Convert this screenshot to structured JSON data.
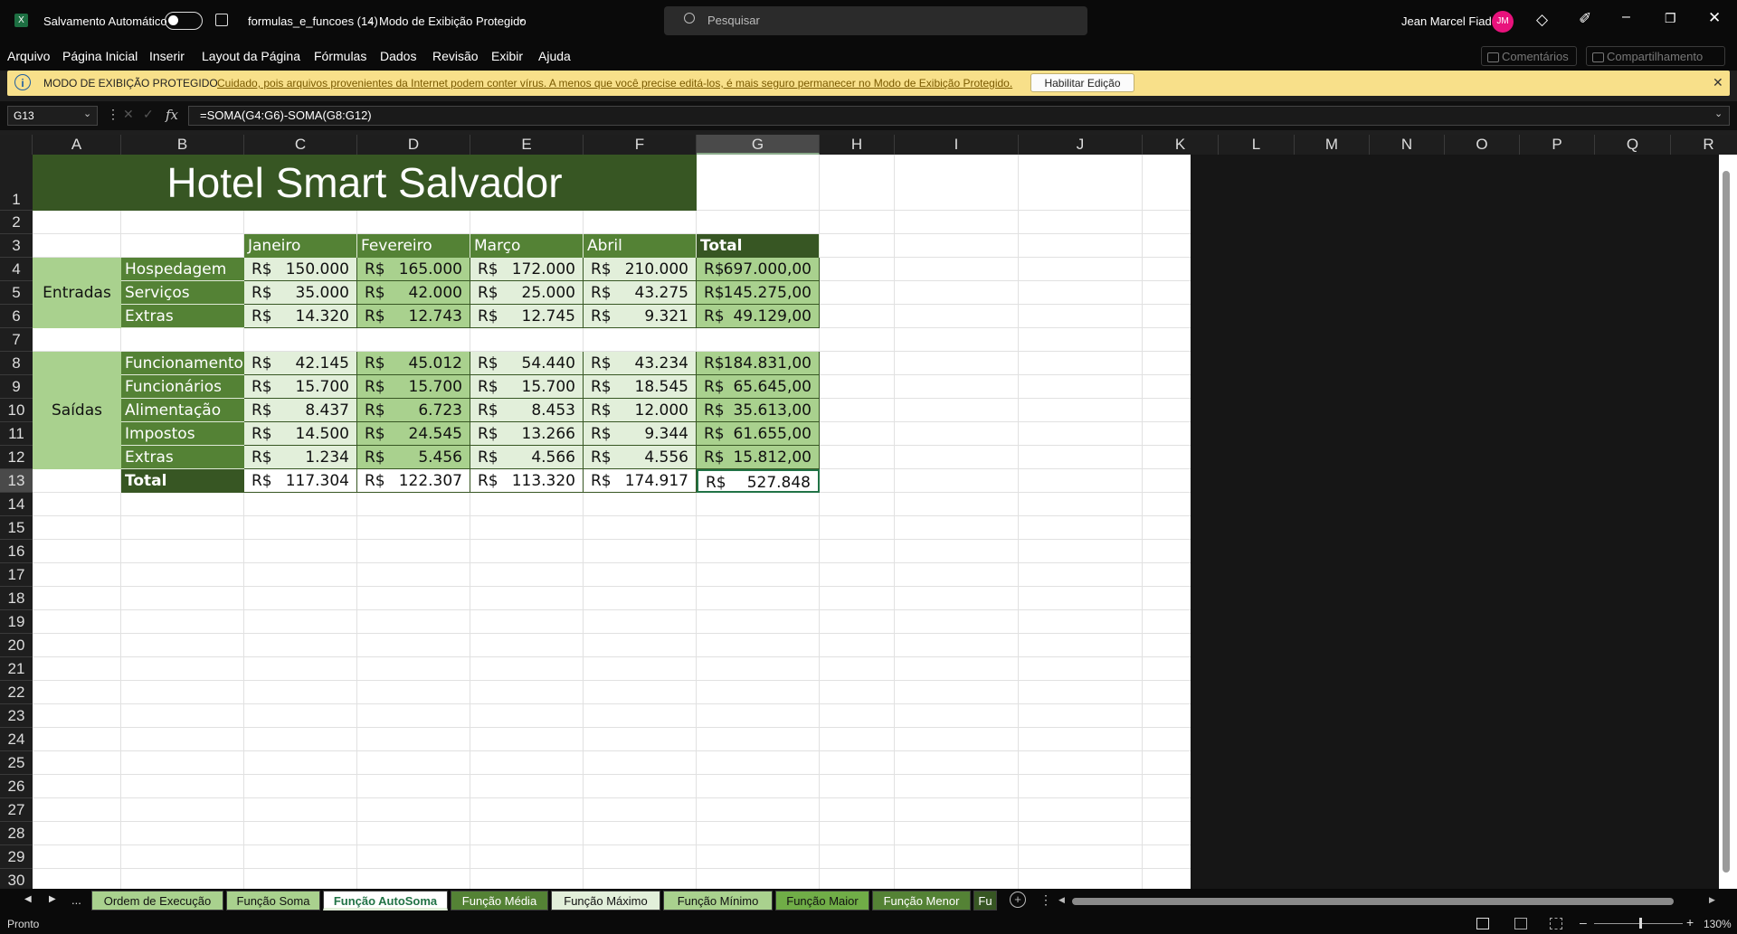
{
  "titlebar": {
    "autosave_label": "Salvamento Automático",
    "file_name": "formulas_e_funcoes (14)",
    "separator": "-",
    "mode": "Modo de Exibição Protegido",
    "search_placeholder": "Pesquisar",
    "user_name": "Jean Marcel Fiad",
    "user_initials": "JM"
  },
  "menu": [
    "Arquivo",
    "Página Inicial",
    "Inserir",
    "Layout da Página",
    "Fórmulas",
    "Dados",
    "Revisão",
    "Exibir",
    "Ajuda"
  ],
  "ribbon_buttons": {
    "comments": "Comentários",
    "share": "Compartilhamento"
  },
  "protected_bar": {
    "title": "MODO DE EXIBIÇÃO PROTEGIDO",
    "message": "Cuidado, pois arquivos provenientes da Internet podem conter vírus. A menos que você precise editá-los, é mais seguro permanecer no Modo de  Exibição Protegido.",
    "enable_button": "Habilitar Edição"
  },
  "formula_bar": {
    "name_box": "G13",
    "formula": "=SOMA(G4:G6)-SOMA(G8:G12)",
    "fx": "fx"
  },
  "columns": [
    "A",
    "B",
    "C",
    "D",
    "E",
    "F",
    "G",
    "H",
    "I",
    "J",
    "K",
    "L",
    "M",
    "N",
    "O",
    "P",
    "Q",
    "R"
  ],
  "rows": [
    "1",
    "2",
    "3",
    "4",
    "5",
    "6",
    "7",
    "8",
    "9",
    "10",
    "11",
    "12",
    "13",
    "14",
    "15",
    "16",
    "17",
    "18",
    "19",
    "20",
    "21",
    "22",
    "23",
    "24",
    "25",
    "26",
    "27",
    "28",
    "29",
    "30"
  ],
  "sheet": {
    "title": "Hotel Smart Salvador",
    "month_headers": [
      "Janeiro",
      "Fevereiro",
      "Março",
      "Abril",
      "Total"
    ],
    "currency": "R$",
    "entradas_label": "Entradas",
    "saidas_label": "Saídas",
    "entradas": [
      {
        "label": "Hospedagem",
        "values": [
          "150.000",
          "165.000",
          "172.000",
          "210.000",
          "697.000,00"
        ]
      },
      {
        "label": "Serviços",
        "values": [
          "35.000",
          "42.000",
          "25.000",
          "43.275",
          "145.275,00"
        ]
      },
      {
        "label": "Extras",
        "values": [
          "14.320",
          "12.743",
          "12.745",
          "9.321",
          "49.129,00"
        ]
      }
    ],
    "saidas": [
      {
        "label": "Funcionamento",
        "values": [
          "42.145",
          "45.012",
          "54.440",
          "43.234",
          "184.831,00"
        ]
      },
      {
        "label": "Funcionários",
        "values": [
          "15.700",
          "15.700",
          "15.700",
          "18.545",
          "65.645,00"
        ]
      },
      {
        "label": "Alimentação",
        "values": [
          "8.437",
          "6.723",
          "8.453",
          "12.000",
          "35.613,00"
        ]
      },
      {
        "label": "Impostos",
        "values": [
          "14.500",
          "24.545",
          "13.266",
          "9.344",
          "61.655,00"
        ]
      },
      {
        "label": "Extras",
        "values": [
          "1.234",
          "5.456",
          "4.566",
          "4.556",
          "15.812,00"
        ]
      }
    ],
    "total_label": "Total",
    "totals": [
      "117.304",
      "122.307",
      "113.320",
      "174.917",
      "527.848"
    ]
  },
  "sheet_tabs": [
    {
      "label": "Ordem de Execução",
      "color": "#a9d18e"
    },
    {
      "label": "Função Soma",
      "color": "#a9d18e"
    },
    {
      "label": "Função AutoSoma",
      "color": "#e2efda",
      "active": true
    },
    {
      "label": "Função Média",
      "color": "#548235"
    },
    {
      "label": "Função Máximo",
      "color": "#e2efda"
    },
    {
      "label": "Função Mínimo",
      "color": "#a9d18e"
    },
    {
      "label": "Função Maior",
      "color": "#70ad47"
    },
    {
      "label": "Função Menor",
      "color": "#548235"
    },
    {
      "label": "Fu",
      "color": "#375623"
    }
  ],
  "tab_more": "...",
  "status": {
    "ready": "Pronto",
    "zoom": "130%"
  },
  "colors": {
    "title_bg": "#375623",
    "header_bg": "#548235",
    "label_bg": "#548235",
    "section_bg": "#a9d18e",
    "value_light": "#e2efda",
    "total_bg": "#375623",
    "protected_bar": "#f8e08a"
  }
}
